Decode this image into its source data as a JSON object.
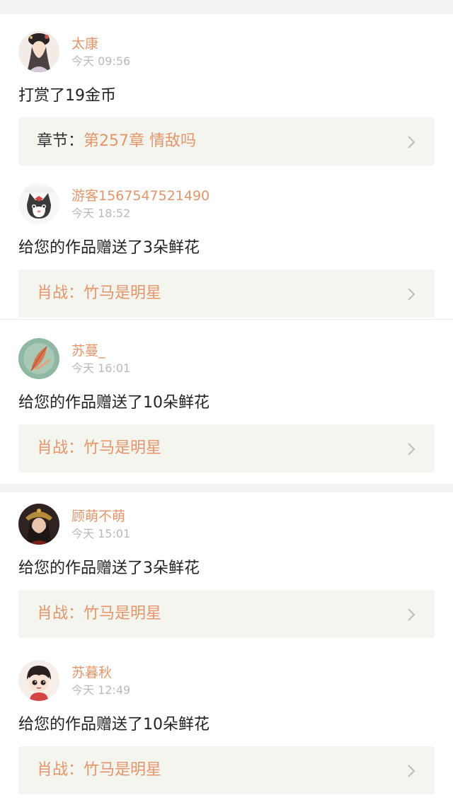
{
  "entries": [
    {
      "name": "太康",
      "time": "今天 09:56",
      "message": "打赏了19金币",
      "link_prefix": "章节：",
      "link_text": "第257章 情敌吗",
      "avatar_icon": "avatar-lady-portrait"
    },
    {
      "name": "游客1567547521490",
      "time": "今天 18:52",
      "message": "给您的作品赠送了3朵鲜花",
      "link_prefix": "肖战：",
      "link_text": "竹马是明星",
      "avatar_icon": "avatar-cat"
    },
    {
      "name": "苏蔓_",
      "time": "今天 16:01",
      "message": "给您的作品赠送了10朵鲜花",
      "link_prefix": "肖战：",
      "link_text": "竹马是明星",
      "avatar_icon": "avatar-green-leaf"
    },
    {
      "name": "顾萌不萌",
      "time": "今天 15:01",
      "message": "给您的作品赠送了3朵鲜花",
      "link_prefix": "肖战：",
      "link_text": "竹马是明星",
      "avatar_icon": "avatar-dark-portrait"
    },
    {
      "name": "苏暮秋",
      "time": "今天 12:49",
      "message": "给您的作品赠送了10朵鲜花",
      "link_prefix": "肖战：",
      "link_text": "竹马是明星",
      "avatar_icon": "avatar-cartoon-boy"
    }
  ],
  "colors": {
    "accent": "#e6956a",
    "time": "#b9b9b9",
    "text": "#222222",
    "bar_bg": "#f5f5f0",
    "separator": "#f2f2f2"
  }
}
